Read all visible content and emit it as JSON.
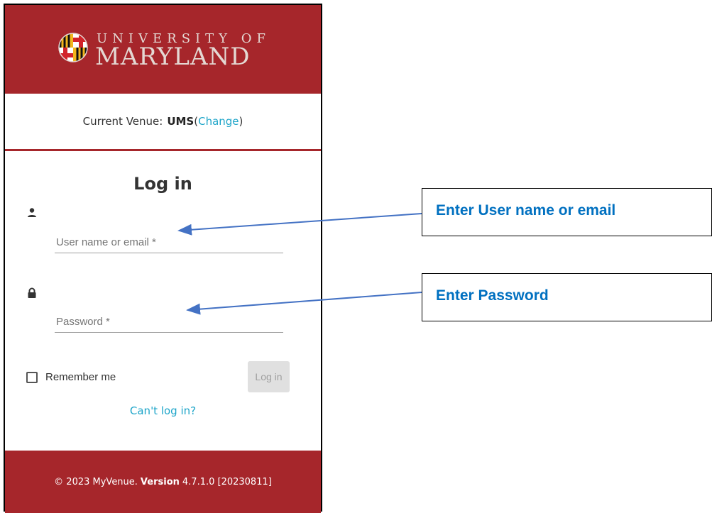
{
  "header": {
    "logo_line1": "UNIVERSITY OF",
    "logo_line2": "MARYLAND",
    "brand_color": "#a6262b"
  },
  "venue": {
    "label": "Current Venue:",
    "name": "UMS",
    "open_paren": "(",
    "change_link": "Change",
    "close_paren": ")"
  },
  "login": {
    "title": "Log in",
    "username_placeholder": "User name or email *",
    "password_placeholder": "Password *",
    "remember_label": "Remember me",
    "button_label": "Log in",
    "cant_login_link": "Can't log in?"
  },
  "footer": {
    "copyright": "© 2023 MyVenue.",
    "version_label": "Version",
    "version_value": "4.7.1.0 [20230811]"
  },
  "annotations": {
    "username_callout": "Enter User name or email",
    "password_callout": "Enter Password",
    "callout_color": "#0070c0",
    "arrow_color": "#4472c4"
  },
  "icons": [
    "maryland-seal-icon",
    "person-icon",
    "lock-icon",
    "checkbox-icon"
  ]
}
